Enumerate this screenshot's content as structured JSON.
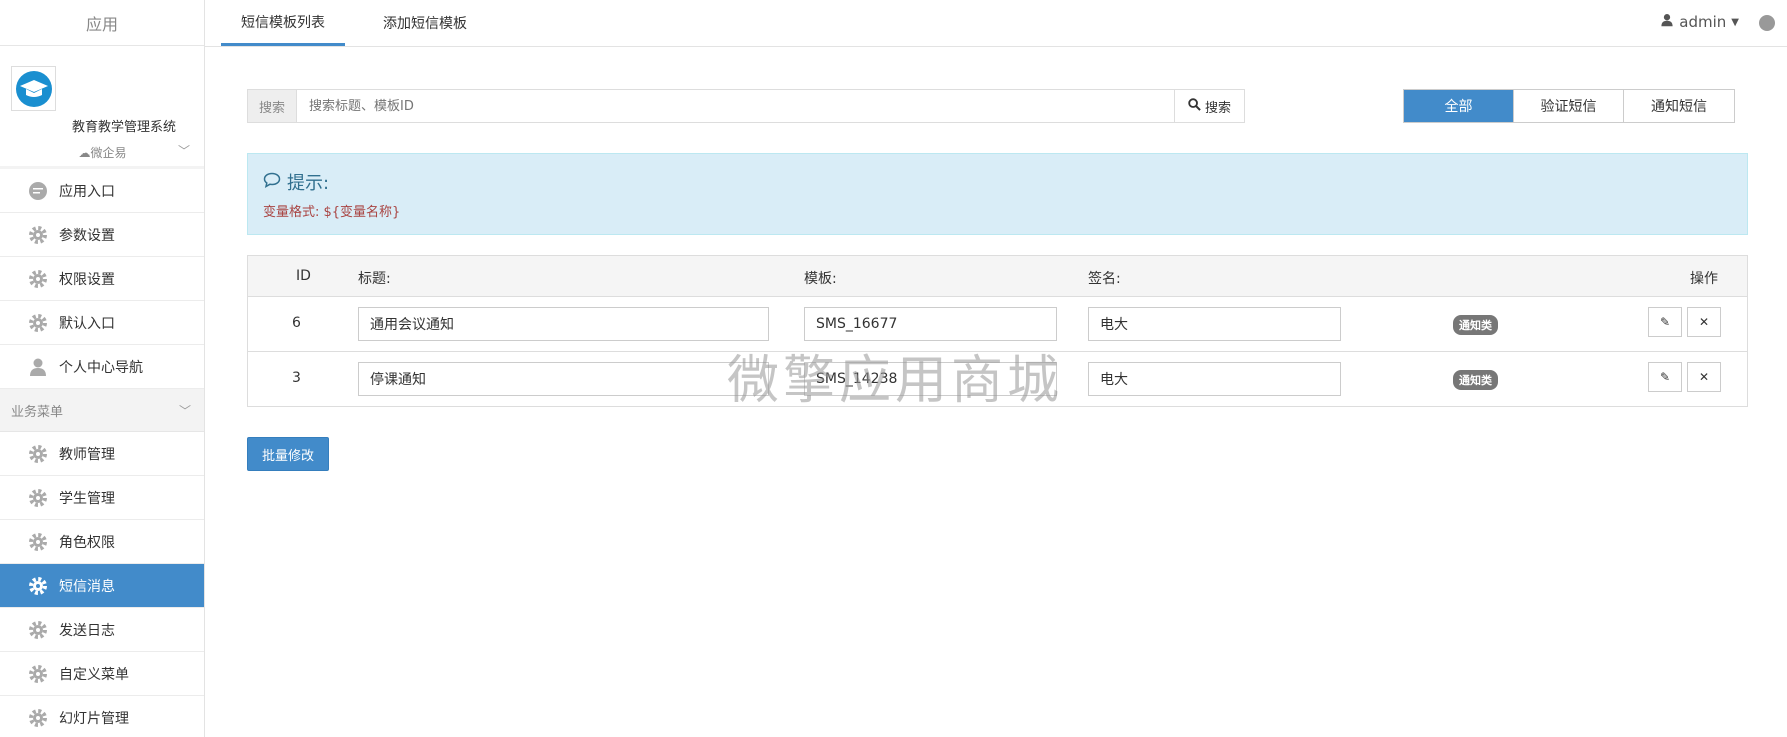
{
  "sidebar": {
    "header": "应用",
    "app_name": "教育教学管理系统",
    "wei_label": "微企易",
    "items_top": [
      {
        "label": "应用入口",
        "icon": "chat-icon"
      },
      {
        "label": "参数设置",
        "icon": "gear-icon"
      },
      {
        "label": "权限设置",
        "icon": "gear-icon"
      },
      {
        "label": "默认入口",
        "icon": "gear-icon"
      },
      {
        "label": "个人中心导航",
        "icon": "user-icon"
      }
    ],
    "section_label": "业务菜单",
    "items_biz": [
      {
        "label": "教师管理",
        "icon": "gear-icon"
      },
      {
        "label": "学生管理",
        "icon": "gear-icon"
      },
      {
        "label": "角色权限",
        "icon": "gear-icon"
      },
      {
        "label": "短信消息",
        "icon": "gear-icon",
        "active": true
      },
      {
        "label": "发送日志",
        "icon": "gear-icon"
      },
      {
        "label": "自定义菜单",
        "icon": "gear-icon"
      },
      {
        "label": "幻灯片管理",
        "icon": "gear-icon"
      }
    ]
  },
  "topbar": {
    "tabs": [
      "短信模板列表",
      "添加短信模板"
    ],
    "user": "admin"
  },
  "search": {
    "label": "搜索",
    "placeholder": "搜索标题、模板ID",
    "button": "搜索"
  },
  "filters": [
    "全部",
    "验证短信",
    "通知短信"
  ],
  "tip": {
    "title": "提示:",
    "body": "变量格式: ${变量名称}"
  },
  "table": {
    "headers": {
      "id": "ID",
      "title": "标题:",
      "template": "模板:",
      "sign": "签名:",
      "action": "操作"
    },
    "rows": [
      {
        "id": "6",
        "title": "通用会议通知",
        "template": "SMS_16677",
        "sign": "电大",
        "badge": "通知类"
      },
      {
        "id": "3",
        "title": "停课通知",
        "template": "SMS_14238",
        "sign": "电大",
        "badge": "通知类"
      }
    ]
  },
  "batch_button": "批量修改",
  "watermark": "微擎应用商城",
  "colors": {
    "primary": "#428bca",
    "tip_bg": "#d9edf7",
    "tip_text": "#a94442"
  }
}
